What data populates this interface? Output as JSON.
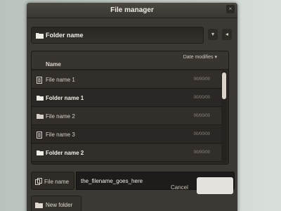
{
  "window": {
    "title": "File manager",
    "close_glyph": "×"
  },
  "location": {
    "icon": "folder-icon",
    "label": "Folder name",
    "dropdown_glyph": "▾",
    "back_glyph": "◂"
  },
  "list": {
    "columns": {
      "name": "Name",
      "date": "Date modifies ▾"
    },
    "rows": [
      {
        "type": "file",
        "name": "File name 1",
        "date": "00/00/00",
        "bold": false
      },
      {
        "type": "folder",
        "name": "Folder name 1",
        "date": "00/00/00",
        "bold": true
      },
      {
        "type": "folder",
        "name": "File name 2",
        "date": "00/00/00",
        "bold": false
      },
      {
        "type": "file",
        "name": "File name 3",
        "date": "00/00/00",
        "bold": false
      },
      {
        "type": "folder",
        "name": "Folder name 2",
        "date": "00/00/00",
        "bold": true
      }
    ]
  },
  "filename": {
    "label": "File name",
    "value": "the_filename_goes_here"
  },
  "actions": {
    "cancel": "Cancel",
    "new_folder": "New folder"
  },
  "colors": {
    "window_bg": "#3c3833",
    "accent_button": "#e4e2dc"
  }
}
